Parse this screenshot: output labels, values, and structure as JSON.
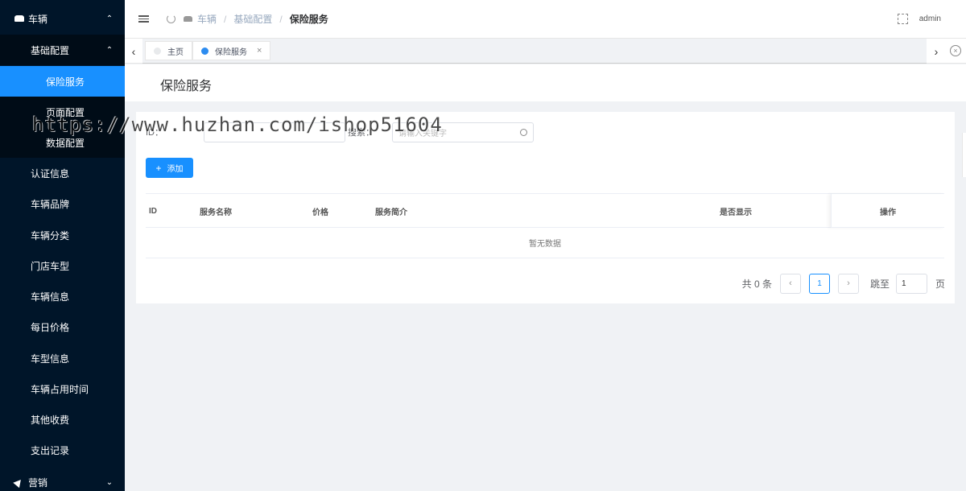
{
  "sidebar": {
    "top_label": "车辆",
    "sub_label": "基础配置",
    "active_label": "保险服务",
    "children": [
      "页面配置",
      "数据配置"
    ],
    "items": [
      "认证信息",
      "车辆品牌",
      "车辆分类",
      "门店车型",
      "车辆信息",
      "每日价格",
      "车型信息",
      "车辆占用时间",
      "其他收费",
      "支出记录"
    ],
    "bottom_label": "营销"
  },
  "header": {
    "breadcrumb": [
      "车辆",
      "基础配置",
      "保险服务"
    ],
    "user": "admin"
  },
  "tabs": {
    "items": [
      {
        "label": "主页"
      },
      {
        "label": "保险服务"
      }
    ],
    "close_glyph": "×"
  },
  "page": {
    "title": "保险服务"
  },
  "filters": {
    "field1_label": "ID：",
    "field2_label": "搜索：",
    "search_placeholder": "请输入关键字"
  },
  "toolbar": {
    "add_label": "添加"
  },
  "table": {
    "columns": [
      "ID",
      "服务名称",
      "价格",
      "服务简介",
      "是否显示",
      "操作"
    ],
    "empty_text": "暂无数据"
  },
  "pagination": {
    "total_text": "共 0 条",
    "current_page": "1",
    "jump_label": "跳至",
    "jump_value": "1",
    "page_suffix": "页"
  },
  "watermark": "https://www.huzhan.com/ishop51604",
  "colors": {
    "sidebar_bg": "#001529",
    "accent": "#1890ff"
  }
}
